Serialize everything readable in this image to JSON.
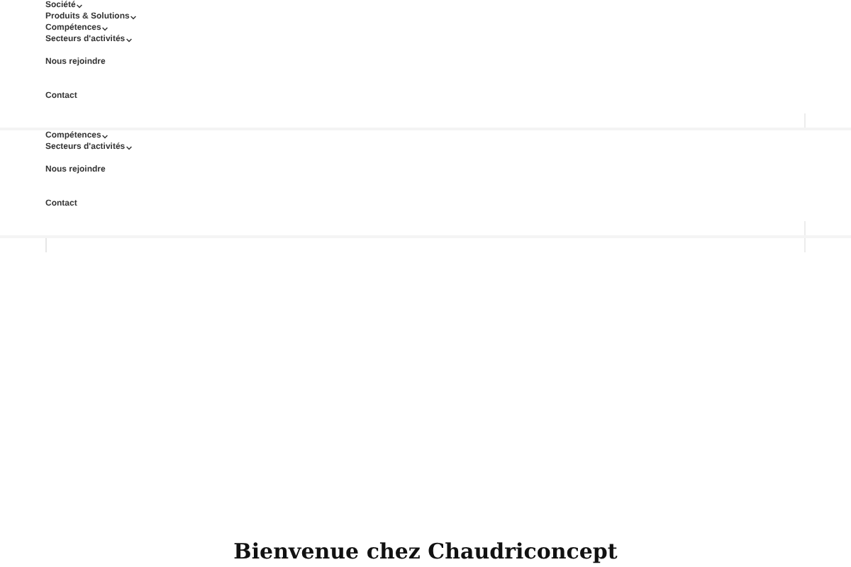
{
  "menus": [
    {
      "items": [
        {
          "label": "Société",
          "kind": "dropdown"
        },
        {
          "label": "Produits & Solutions",
          "kind": "dropdown"
        },
        {
          "label": "Compétences",
          "kind": "dropdown"
        },
        {
          "label": "Secteurs d'activités",
          "kind": "dropdown"
        },
        {
          "label": "Nous rejoindre",
          "kind": "link"
        },
        {
          "label": "Contact",
          "kind": "link"
        }
      ]
    },
    {
      "items": [
        {
          "label": "Compétences",
          "kind": "dropdown"
        },
        {
          "label": "Secteurs d'activités",
          "kind": "dropdown"
        },
        {
          "label": "Nous rejoindre",
          "kind": "link"
        },
        {
          "label": "Contact",
          "kind": "link"
        }
      ]
    }
  ],
  "heading": "Bienvenue chez Chaudriconcept"
}
